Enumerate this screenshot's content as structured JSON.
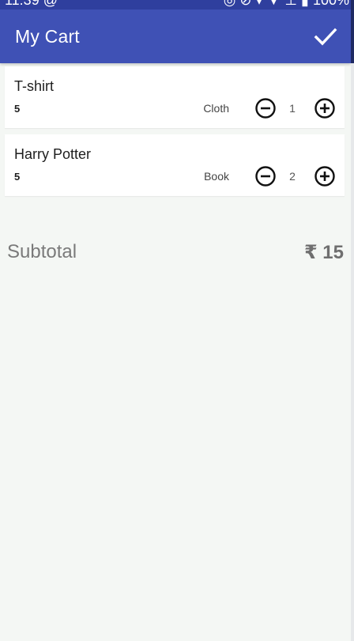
{
  "status_bar": {
    "left_text": "11:39  @",
    "right_text": "◎ ⊘ ▾ ▼ ⊥ ▮ 100%"
  },
  "toolbar": {
    "title": "My Cart",
    "confirm_icon": "check-icon",
    "background_color": "#3f51b5"
  },
  "cart": {
    "items": [
      {
        "name": "T-shirt",
        "price": "5",
        "category": "Cloth",
        "quantity": "1",
        "minus_icon": "minus-circle-icon",
        "plus_icon": "plus-circle-icon"
      },
      {
        "name": "Harry Potter",
        "price": "5",
        "category": "Book",
        "quantity": "2",
        "minus_icon": "minus-circle-icon",
        "plus_icon": "plus-circle-icon"
      }
    ]
  },
  "summary": {
    "subtotal_label": "Subtotal",
    "subtotal_value": "₹ 15"
  }
}
